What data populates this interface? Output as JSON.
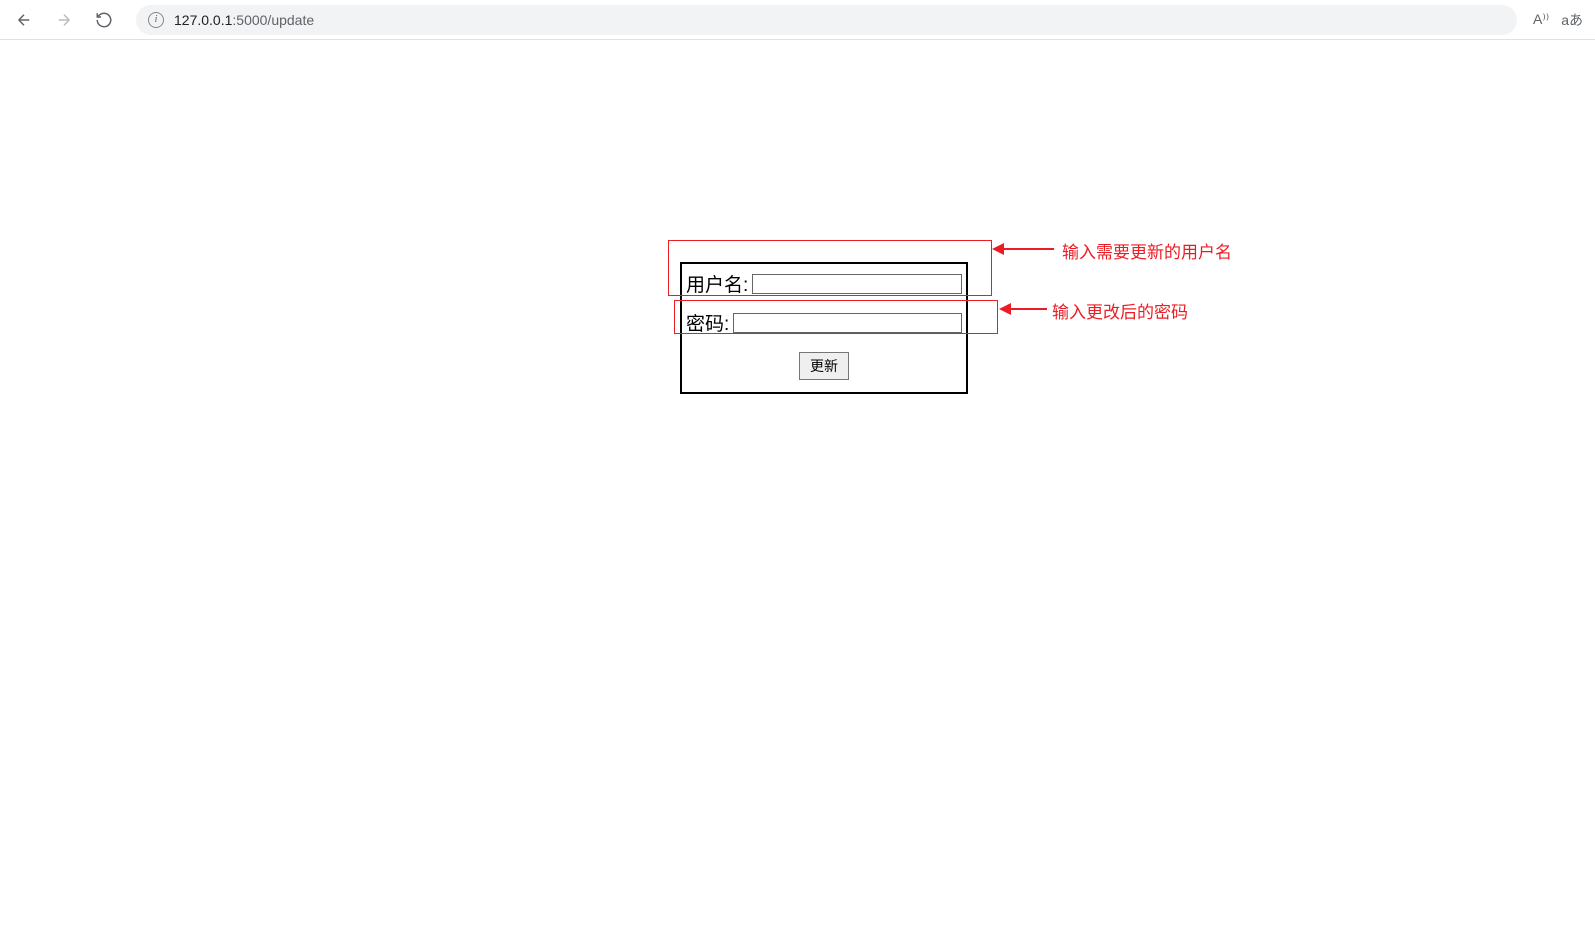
{
  "browser": {
    "url_host": "127.0.0.1",
    "url_port_path": ":5000/update",
    "read_aloud_label": "A⁾⁾",
    "translate_label": "aあ"
  },
  "form": {
    "username_label": "用户名:",
    "username_value": "",
    "password_label": "密码:",
    "password_value": "",
    "submit_label": "更新"
  },
  "annotations": {
    "text1": "输入需要更新的用户名",
    "text2": "输入更改后的密码"
  }
}
